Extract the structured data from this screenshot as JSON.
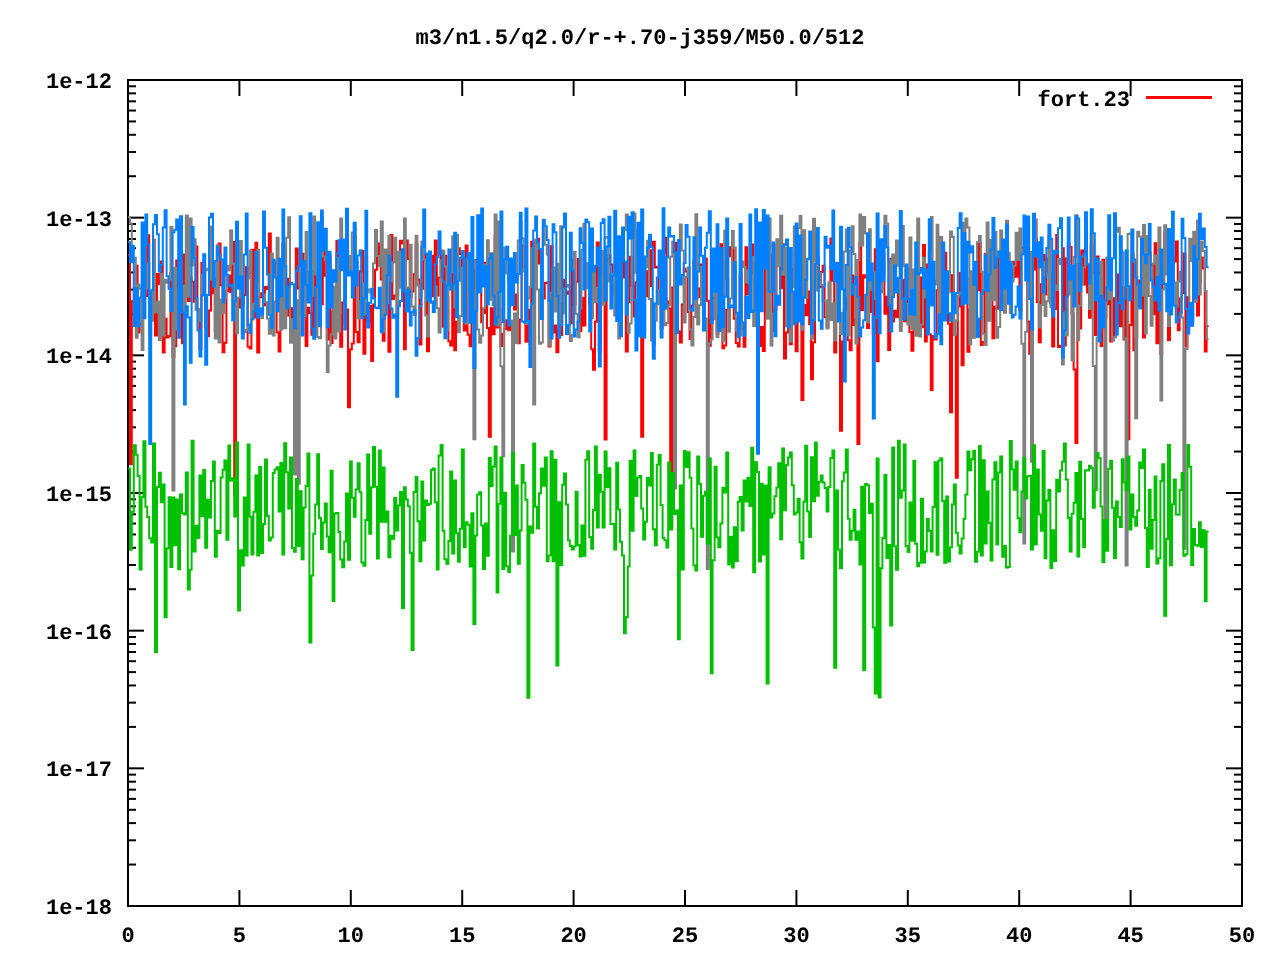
{
  "title": "m3/n1.5/q2.0/r-+.70-j359/M50.0/512",
  "y_tick_labels": [
    "1e-12",
    "1e-13",
    "1e-14",
    "1e-15",
    "1e-16",
    "1e-17",
    "1e-18"
  ],
  "x_tick_labels": [
    "0",
    "5",
    "10",
    "15",
    "20",
    "25",
    "30",
    "35",
    "40",
    "45",
    "50"
  ],
  "legend": {
    "label": "fort.23",
    "color": "#ff0000"
  }
}
